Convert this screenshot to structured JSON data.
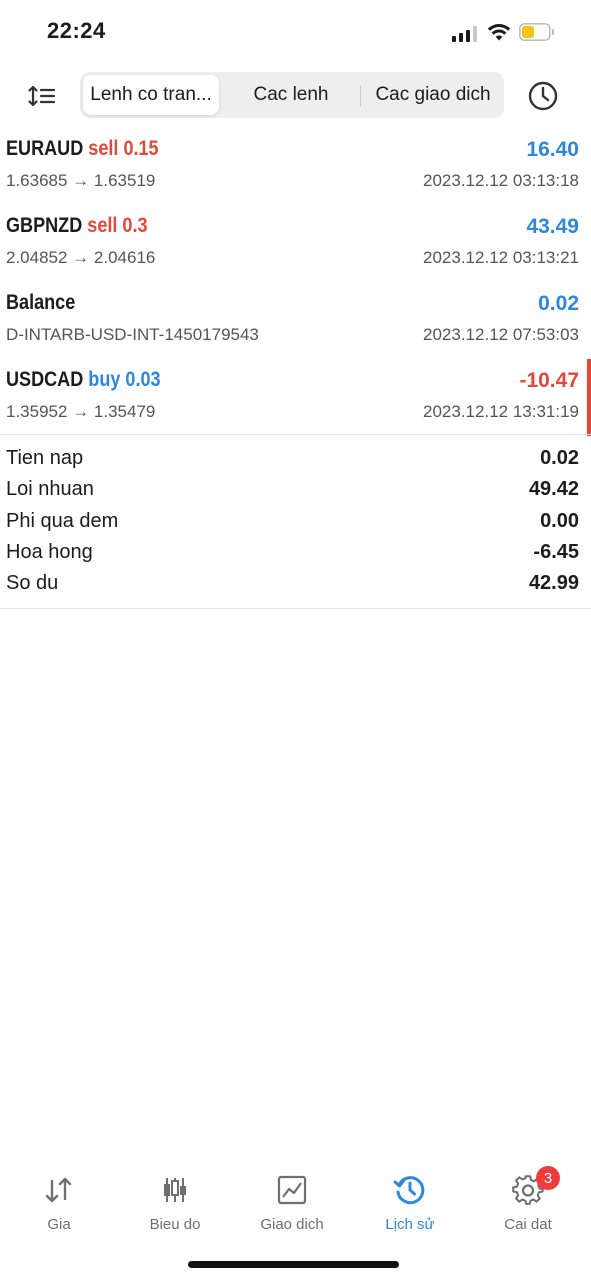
{
  "status_bar": {
    "time": "22:24",
    "battery_color": "#f5c518"
  },
  "toolbar": {
    "sort_icon": "sort-icon",
    "tabs": [
      {
        "label": "Lenh co tran..."
      },
      {
        "label": "Cac lenh"
      },
      {
        "label": "Cac giao dich"
      }
    ],
    "active_tab": 0,
    "history_icon": "clock-icon"
  },
  "deals": [
    {
      "symbol": "EURAUD",
      "side": "sell",
      "volume": "0.15",
      "profit": "16.40",
      "prices": "1.63685 → 1.63519",
      "time": "2023.12.12 03:13:18"
    },
    {
      "symbol": "GBPNZD",
      "side": "sell",
      "volume": "0.3",
      "profit": "43.49",
      "prices": "2.04852 → 2.04616",
      "time": "2023.12.12 03:13:21"
    },
    {
      "symbol": "Balance",
      "side": "",
      "volume": "",
      "profit": "0.02",
      "prices": "D-INTARB-USD-INT-1450179543",
      "time": "2023.12.12 07:53:03"
    },
    {
      "symbol": "USDCAD",
      "side": "buy",
      "volume": "0.03",
      "profit": "-10.47",
      "prices": "1.35952 → 1.35479",
      "time": "2023.12.12 13:31:19"
    }
  ],
  "summary": [
    {
      "label": "Tien nap",
      "value": "0.02"
    },
    {
      "label": "Loi nhuan",
      "value": "49.42"
    },
    {
      "label": "Phi qua dem",
      "value": "0.00"
    },
    {
      "label": "Hoa hong",
      "value": "-6.45"
    },
    {
      "label": "So du",
      "value": "42.99"
    }
  ],
  "tabbar": {
    "items": [
      {
        "label": "Gia",
        "icon": "quotes-icon"
      },
      {
        "label": "Bieu do",
        "icon": "candlestick-chart-icon"
      },
      {
        "label": "Giao dich",
        "icon": "trade-chart-icon"
      },
      {
        "label": "Lịch sử",
        "icon": "history-icon"
      },
      {
        "label": "Cai dat",
        "icon": "gear-icon",
        "badge": "3"
      }
    ],
    "active_index": 3
  },
  "colors": {
    "accent": "#2d87e0",
    "negative": "#e8453c",
    "badge": "#ef3b3b"
  }
}
